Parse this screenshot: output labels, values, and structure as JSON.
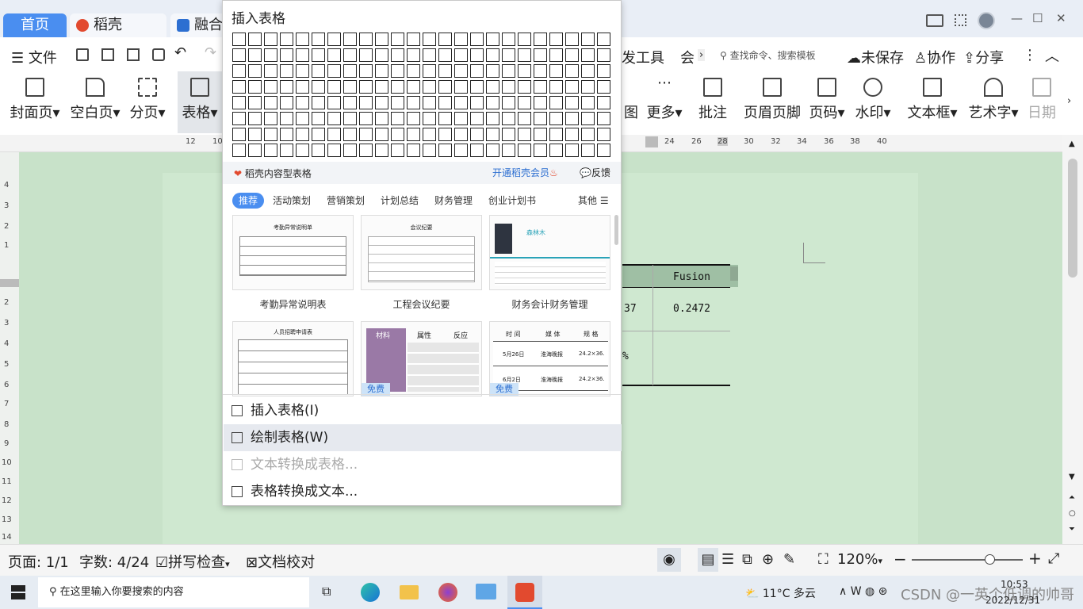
{
  "titlebar": {
    "tabs": [
      "首页",
      "稻壳",
      "融合"
    ],
    "window_controls": [
      "minimize-icon",
      "maximize-icon",
      "close-icon"
    ]
  },
  "menu": {
    "file_label": "文件",
    "items_right": [
      "发工具",
      "会"
    ],
    "search_placeholder": "查找命令、搜索模板",
    "unsaved": "未保存",
    "collab": "协作",
    "share": "分享"
  },
  "ribbon": {
    "left": [
      {
        "label": "封面页",
        "icon": "cover-page-icon"
      },
      {
        "label": "空白页",
        "icon": "blank-page-icon"
      },
      {
        "label": "分页",
        "icon": "page-break-icon"
      },
      {
        "label": "表格",
        "icon": "table-icon"
      }
    ],
    "right": [
      {
        "label": "图",
        "icon": "chart-icon"
      },
      {
        "label": "更多",
        "icon": "more-icon"
      },
      {
        "label": "批注",
        "icon": "comment-icon"
      },
      {
        "label": "页眉页脚",
        "icon": "header-footer-icon"
      },
      {
        "label": "页码",
        "icon": "page-number-icon"
      },
      {
        "label": "水印",
        "icon": "watermark-icon"
      },
      {
        "label": "文本框",
        "icon": "textbox-icon"
      },
      {
        "label": "艺术字",
        "icon": "wordart-icon"
      },
      {
        "label": "日期",
        "icon": "date-icon"
      }
    ]
  },
  "ruler": {
    "ticks_left": [
      "12",
      "10"
    ],
    "ticks_right": [
      "24",
      "26",
      "28",
      "30",
      "32",
      "34",
      "36",
      "38",
      "40"
    ]
  },
  "vruler": {
    "ticks": [
      "4",
      "3",
      "2",
      "1",
      "1",
      "2",
      "3",
      "4",
      "5",
      "6",
      "7",
      "8",
      "9",
      "10",
      "11",
      "12",
      "13",
      "14"
    ]
  },
  "doc_table": {
    "header": "Fusion",
    "cell_left_partial": "37",
    "cell_value": "0.2472",
    "cell_left_row2": "%"
  },
  "popup": {
    "title": "插入表格",
    "grid_cols": 24,
    "grid_rows": 8,
    "docer_label": "稻壳内容型表格",
    "vip_link": "开通稻壳会员",
    "feedback": "反馈",
    "categories": [
      "推荐",
      "活动策划",
      "营销策划",
      "计划总结",
      "财务管理",
      "创业计划书"
    ],
    "more_label": "其他",
    "templates": [
      {
        "caption": "考勤异常说明表",
        "free": ""
      },
      {
        "caption": "工程会议纪要",
        "free": ""
      },
      {
        "caption": "财务会计财务管理",
        "free": ""
      },
      {
        "caption": "",
        "free": ""
      },
      {
        "caption": "",
        "free": "免费"
      },
      {
        "caption": "",
        "free": "免费"
      }
    ],
    "thumb_texts": {
      "t1_title": "考勤异常说明单",
      "t2_title": "会议纪要",
      "t3_name": "森林木",
      "t4_title": "人员招聘申请表",
      "t5_headers": [
        "材料",
        "属性",
        "反应"
      ],
      "t6_headers": [
        "时 间",
        "媒 体",
        "规 格"
      ],
      "t6_rows": [
        [
          "5月26日",
          "淮海晚报",
          "24.2×36."
        ],
        [
          "6月2日",
          "淮海晚报",
          "24.2×36."
        ]
      ]
    },
    "menu_items": [
      {
        "label": "插入表格(I)",
        "enabled": true,
        "icon": "insert-table-icon"
      },
      {
        "label": "绘制表格(W)",
        "enabled": true,
        "icon": "draw-table-icon"
      },
      {
        "label": "文本转换成表格...",
        "enabled": false,
        "icon": "text-to-table-icon"
      },
      {
        "label": "表格转换成文本...",
        "enabled": true,
        "icon": "table-to-text-icon"
      }
    ]
  },
  "status": {
    "page": "页面: 1/1",
    "words": "字数: 4/24",
    "spell": "拼写检查",
    "proof": "文档校对",
    "zoom": "120%",
    "zoom_level": 0.7
  },
  "taskbar": {
    "search_placeholder": "在这里输入你要搜索的内容",
    "weather": "11°C 多云",
    "time": "10:53",
    "date": "2022/12/31",
    "watermark": "CSDN @一英个低调的帅哥"
  },
  "colors": {
    "accent": "#4a8ef0",
    "doc_bg": "#c8e2c9",
    "docer_red": "#e24a2f"
  }
}
